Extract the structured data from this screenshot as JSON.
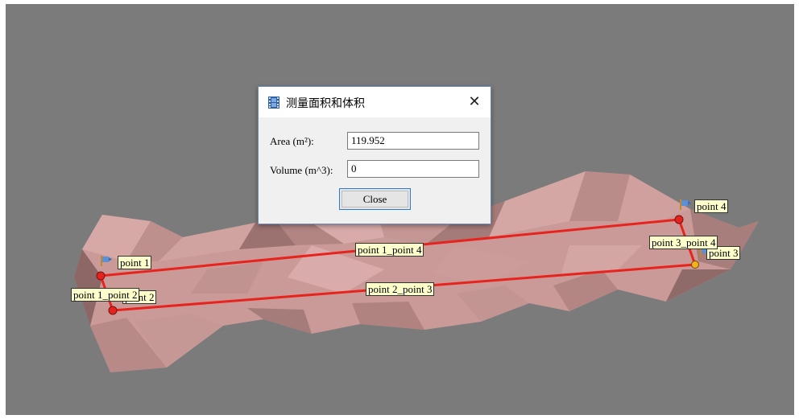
{
  "dialog": {
    "title": "测量面积和体积",
    "title_icon": "film-strip-icon",
    "close_icon": "close-x-icon",
    "close_glyph": "✕",
    "area_label": "Area (m²):",
    "area_value": "119.952",
    "volume_label": "Volume (m^3):",
    "volume_value": "0",
    "close_button": "Close"
  },
  "scene": {
    "points": [
      {
        "label": "point 1",
        "icon": "flag-icon"
      },
      {
        "label": "point 2",
        "icon": "flag-icon"
      },
      {
        "label": "point 3",
        "icon": "flag-icon"
      },
      {
        "label": "point 4",
        "icon": "flag-icon"
      }
    ],
    "segments": [
      "point 1_point 2",
      "point 1_point 4",
      "point 2_point 3",
      "point 3_point 4"
    ],
    "colors": {
      "background": "#7b7b7b",
      "mesh": "#c99a98",
      "line": "#e8231d",
      "marker": "#e3231e",
      "label_bg": "#ffffcc"
    }
  }
}
